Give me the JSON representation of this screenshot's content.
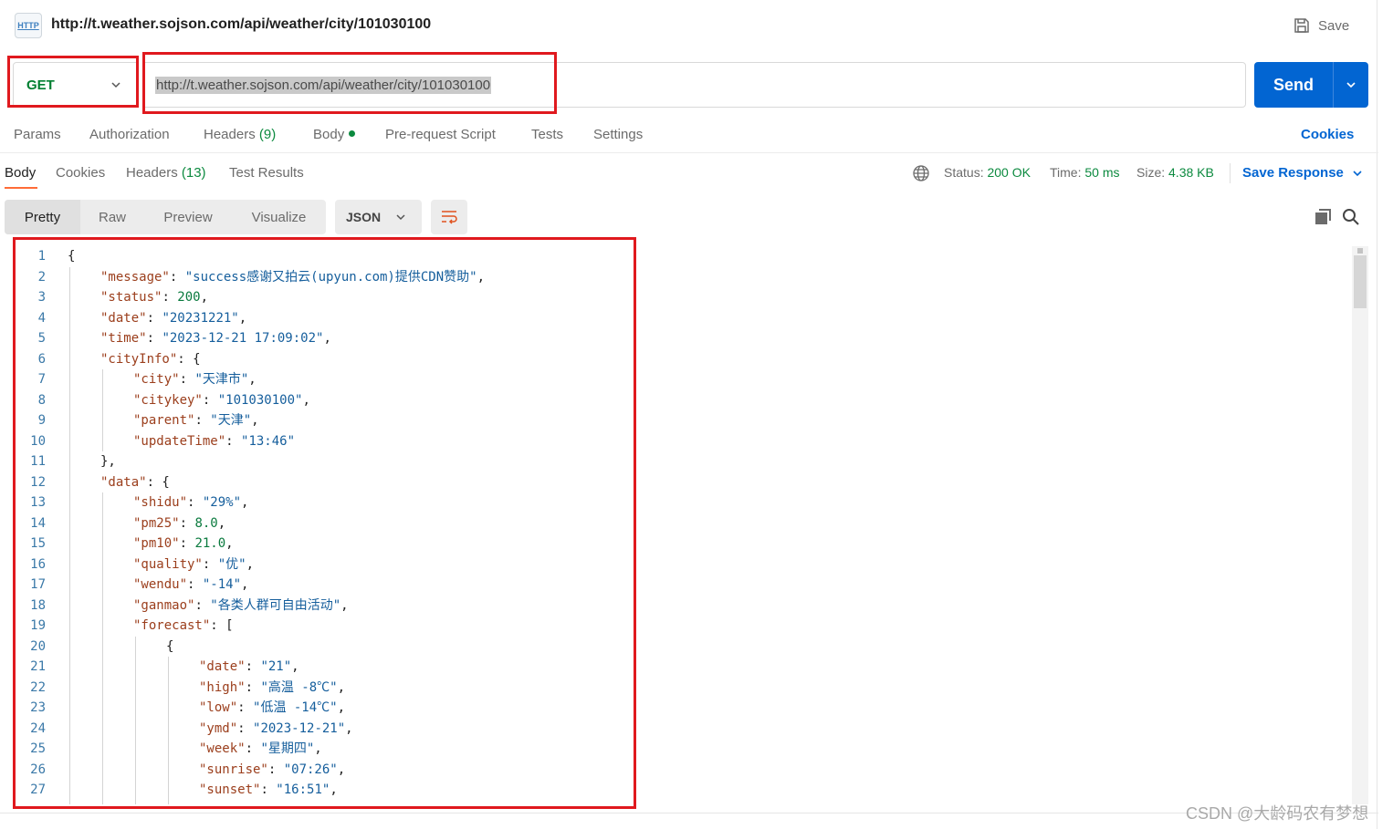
{
  "request": {
    "title": "http://t.weather.sojson.com/api/weather/city/101030100",
    "icon_text": "HTTP",
    "save_label": "Save",
    "method": "GET",
    "url": "http://t.weather.sojson.com/api/weather/city/101030100",
    "send_label": "Send"
  },
  "request_tabs": {
    "params": "Params",
    "authorization": "Authorization",
    "headers": "Headers",
    "headers_count": "(9)",
    "body": "Body",
    "prerequest": "Pre-request Script",
    "tests": "Tests",
    "settings": "Settings",
    "cookies": "Cookies"
  },
  "response_tabs": {
    "body": "Body",
    "cookies": "Cookies",
    "headers": "Headers",
    "headers_count": "(13)",
    "test_results": "Test Results"
  },
  "response_meta": {
    "status_label": "Status:",
    "status_value": "200 OK",
    "time_label": "Time:",
    "time_value": "50 ms",
    "size_label": "Size:",
    "size_value": "4.38 KB",
    "save_response": "Save Response"
  },
  "view": {
    "modes": [
      "Pretty",
      "Raw",
      "Preview",
      "Visualize"
    ],
    "format": "JSON"
  },
  "code_lines": [
    {
      "n": "1",
      "indent": 0,
      "parts": [
        [
          "p",
          "{"
        ]
      ]
    },
    {
      "n": "2",
      "indent": 1,
      "parts": [
        [
          "k",
          "\"message\""
        ],
        [
          "p",
          ": "
        ],
        [
          "s",
          "\"success感谢又拍云(upyun.com)提供CDN赞助\""
        ],
        [
          "p",
          ","
        ]
      ]
    },
    {
      "n": "3",
      "indent": 1,
      "parts": [
        [
          "k",
          "\"status\""
        ],
        [
          "p",
          ": "
        ],
        [
          "n",
          "200"
        ],
        [
          "p",
          ","
        ]
      ]
    },
    {
      "n": "4",
      "indent": 1,
      "parts": [
        [
          "k",
          "\"date\""
        ],
        [
          "p",
          ": "
        ],
        [
          "s",
          "\"20231221\""
        ],
        [
          "p",
          ","
        ]
      ]
    },
    {
      "n": "5",
      "indent": 1,
      "parts": [
        [
          "k",
          "\"time\""
        ],
        [
          "p",
          ": "
        ],
        [
          "s",
          "\"2023-12-21 17:09:02\""
        ],
        [
          "p",
          ","
        ]
      ]
    },
    {
      "n": "6",
      "indent": 1,
      "parts": [
        [
          "k",
          "\"cityInfo\""
        ],
        [
          "p",
          ": {"
        ]
      ]
    },
    {
      "n": "7",
      "indent": 2,
      "parts": [
        [
          "k",
          "\"city\""
        ],
        [
          "p",
          ": "
        ],
        [
          "s",
          "\"天津市\""
        ],
        [
          "p",
          ","
        ]
      ]
    },
    {
      "n": "8",
      "indent": 2,
      "parts": [
        [
          "k",
          "\"citykey\""
        ],
        [
          "p",
          ": "
        ],
        [
          "s",
          "\"101030100\""
        ],
        [
          "p",
          ","
        ]
      ]
    },
    {
      "n": "9",
      "indent": 2,
      "parts": [
        [
          "k",
          "\"parent\""
        ],
        [
          "p",
          ": "
        ],
        [
          "s",
          "\"天津\""
        ],
        [
          "p",
          ","
        ]
      ]
    },
    {
      "n": "10",
      "indent": 2,
      "parts": [
        [
          "k",
          "\"updateTime\""
        ],
        [
          "p",
          ": "
        ],
        [
          "s",
          "\"13:46\""
        ]
      ]
    },
    {
      "n": "11",
      "indent": 1,
      "parts": [
        [
          "p",
          "},"
        ]
      ]
    },
    {
      "n": "12",
      "indent": 1,
      "parts": [
        [
          "k",
          "\"data\""
        ],
        [
          "p",
          ": {"
        ]
      ]
    },
    {
      "n": "13",
      "indent": 2,
      "parts": [
        [
          "k",
          "\"shidu\""
        ],
        [
          "p",
          ": "
        ],
        [
          "s",
          "\"29%\""
        ],
        [
          "p",
          ","
        ]
      ]
    },
    {
      "n": "14",
      "indent": 2,
      "parts": [
        [
          "k",
          "\"pm25\""
        ],
        [
          "p",
          ": "
        ],
        [
          "n",
          "8.0"
        ],
        [
          "p",
          ","
        ]
      ]
    },
    {
      "n": "15",
      "indent": 2,
      "parts": [
        [
          "k",
          "\"pm10\""
        ],
        [
          "p",
          ": "
        ],
        [
          "n",
          "21.0"
        ],
        [
          "p",
          ","
        ]
      ]
    },
    {
      "n": "16",
      "indent": 2,
      "parts": [
        [
          "k",
          "\"quality\""
        ],
        [
          "p",
          ": "
        ],
        [
          "s",
          "\"优\""
        ],
        [
          "p",
          ","
        ]
      ]
    },
    {
      "n": "17",
      "indent": 2,
      "parts": [
        [
          "k",
          "\"wendu\""
        ],
        [
          "p",
          ": "
        ],
        [
          "s",
          "\"-14\""
        ],
        [
          "p",
          ","
        ]
      ]
    },
    {
      "n": "18",
      "indent": 2,
      "parts": [
        [
          "k",
          "\"ganmao\""
        ],
        [
          "p",
          ": "
        ],
        [
          "s",
          "\"各类人群可自由活动\""
        ],
        [
          "p",
          ","
        ]
      ]
    },
    {
      "n": "19",
      "indent": 2,
      "parts": [
        [
          "k",
          "\"forecast\""
        ],
        [
          "p",
          ": ["
        ]
      ]
    },
    {
      "n": "20",
      "indent": 3,
      "parts": [
        [
          "p",
          "{"
        ]
      ]
    },
    {
      "n": "21",
      "indent": 4,
      "parts": [
        [
          "k",
          "\"date\""
        ],
        [
          "p",
          ": "
        ],
        [
          "s",
          "\"21\""
        ],
        [
          "p",
          ","
        ]
      ]
    },
    {
      "n": "22",
      "indent": 4,
      "parts": [
        [
          "k",
          "\"high\""
        ],
        [
          "p",
          ": "
        ],
        [
          "s",
          "\"高温 -8℃\""
        ],
        [
          "p",
          ","
        ]
      ]
    },
    {
      "n": "23",
      "indent": 4,
      "parts": [
        [
          "k",
          "\"low\""
        ],
        [
          "p",
          ": "
        ],
        [
          "s",
          "\"低温 -14℃\""
        ],
        [
          "p",
          ","
        ]
      ]
    },
    {
      "n": "24",
      "indent": 4,
      "parts": [
        [
          "k",
          "\"ymd\""
        ],
        [
          "p",
          ": "
        ],
        [
          "s",
          "\"2023-12-21\""
        ],
        [
          "p",
          ","
        ]
      ]
    },
    {
      "n": "25",
      "indent": 4,
      "parts": [
        [
          "k",
          "\"week\""
        ],
        [
          "p",
          ": "
        ],
        [
          "s",
          "\"星期四\""
        ],
        [
          "p",
          ","
        ]
      ]
    },
    {
      "n": "26",
      "indent": 4,
      "parts": [
        [
          "k",
          "\"sunrise\""
        ],
        [
          "p",
          ": "
        ],
        [
          "s",
          "\"07:26\""
        ],
        [
          "p",
          ","
        ]
      ]
    },
    {
      "n": "27",
      "indent": 4,
      "parts": [
        [
          "k",
          "\"sunset\""
        ],
        [
          "p",
          ": "
        ],
        [
          "s",
          "\"16:51\""
        ],
        [
          "p",
          ","
        ]
      ]
    }
  ],
  "watermark": "CSDN @大龄码农有梦想",
  "colors": {
    "send_button": "#0265d2",
    "method_get": "#007f31",
    "annotation_box": "#e0191e",
    "active_tab_underline": "#ff6c37",
    "status_ok": "#0c8a3f"
  },
  "icons": [
    "http-icon",
    "save-icon",
    "chevron-down-icon",
    "globe-icon",
    "wrap-lines-icon",
    "copy-icon",
    "search-icon"
  ]
}
